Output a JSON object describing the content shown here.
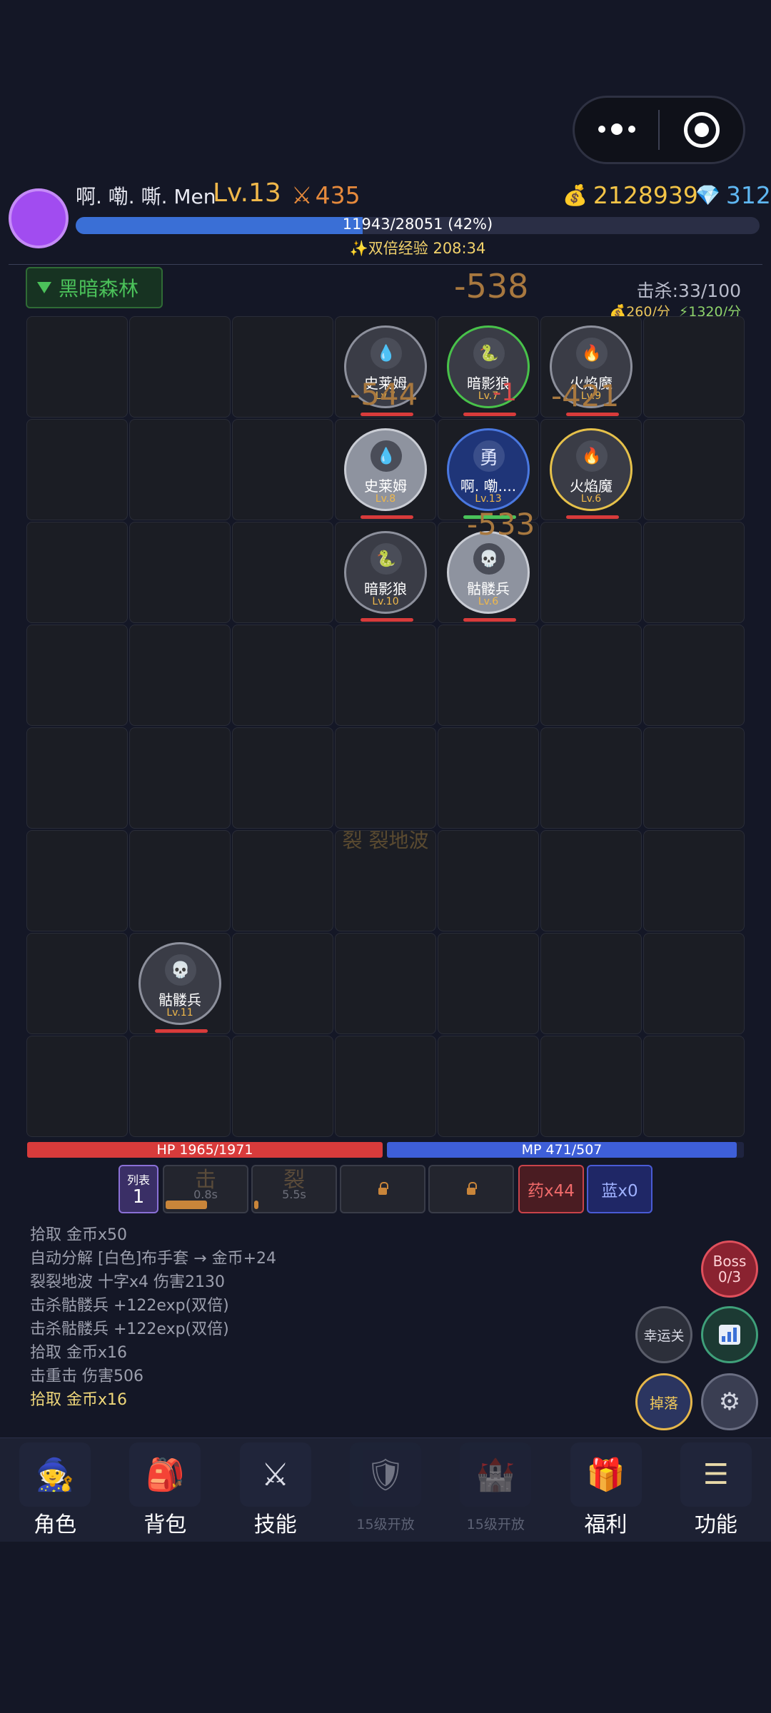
{
  "player": {
    "name": "啊. 嘞. 嘶. Men",
    "level": "Lv.13",
    "attack": "435",
    "gold": "2128939",
    "gems": "312",
    "exp_text": "11943/28051 (42%)",
    "exp_progress": 0.42,
    "double_exp": "✨双倍经验 208:34"
  },
  "zone": {
    "name": "黑暗森林",
    "damage": "-538",
    "kills": "击杀:33/100",
    "gold_rate": "💰260/分",
    "exp_rate": "⚡1320/分"
  },
  "battle": {
    "skill_text": "裂 裂地波",
    "damage_numbers": [
      "-544",
      "-1",
      "-421",
      "-533"
    ],
    "units": [
      {
        "name": "史莱姆",
        "level": "Lv.7",
        "face": "💧",
        "style": "normal"
      },
      {
        "name": "暗影狼",
        "level": "Lv.7",
        "face": "🐍",
        "style": "green"
      },
      {
        "name": "火焰魔",
        "level": "Lv.9",
        "face": "🔥",
        "style": "normal"
      },
      {
        "name": "史莱姆",
        "level": "Lv.8",
        "face": "💧",
        "style": "light"
      },
      {
        "name": "啊. 嘞....",
        "level": "Lv.13",
        "face": "勇",
        "style": "hero"
      },
      {
        "name": "火焰魔",
        "level": "Lv.6",
        "face": "🔥",
        "style": "gold"
      },
      {
        "name": "暗影狼",
        "level": "Lv.10",
        "face": "🐍",
        "style": "normal"
      },
      {
        "name": "骷髅兵",
        "level": "Lv.6",
        "face": "💀",
        "style": "light"
      },
      {
        "name": "骷髅兵",
        "level": "Lv.11",
        "face": "💀",
        "style": "normal"
      }
    ]
  },
  "stats": {
    "hp": "HP 1965/1971",
    "mp": "MP 471/507"
  },
  "skillbar": {
    "list_label": "列表",
    "list_count": "1",
    "skill1": {
      "char": "击",
      "cooldown": "0.8s",
      "progress": 0.5
    },
    "skill2": {
      "char": "裂",
      "cooldown": "5.5s",
      "progress": 0.05
    },
    "potion": "药x44",
    "mana": "蓝x0"
  },
  "log": [
    "拾取 金币x50",
    "自动分解 [白色]布手套 → 金币+24",
    "裂裂地波 十字x4 伤害2130",
    "击杀骷髅兵 +122exp(双倍)",
    "击杀骷髅兵 +122exp(双倍)",
    "拾取 金币x16",
    "击重击 伤害506",
    "拾取 金币x16"
  ],
  "side_buttons": {
    "boss": "Boss",
    "boss_count": "0/3",
    "lucky": "幸运关",
    "drop": "掉落",
    "settings_icon": "gear-icon",
    "stats_icon": "chart-icon"
  },
  "nav": [
    {
      "label": "角色",
      "icon": "🧙"
    },
    {
      "label": "背包",
      "icon": "🎒"
    },
    {
      "label": "技能",
      "icon": "⚔"
    },
    {
      "label": "15级开放",
      "icon": "🛡"
    },
    {
      "label": "15级开放",
      "icon": "🏰"
    },
    {
      "label": "福利",
      "icon": "🎁"
    },
    {
      "label": "功能",
      "icon": "☰"
    }
  ],
  "colors": {
    "background": "#141726",
    "gold": "#f3c447",
    "gem": "#5fb7f2",
    "hp": "#d83b3b",
    "mp": "#3e5fd8",
    "zone": "#4bc25a"
  }
}
